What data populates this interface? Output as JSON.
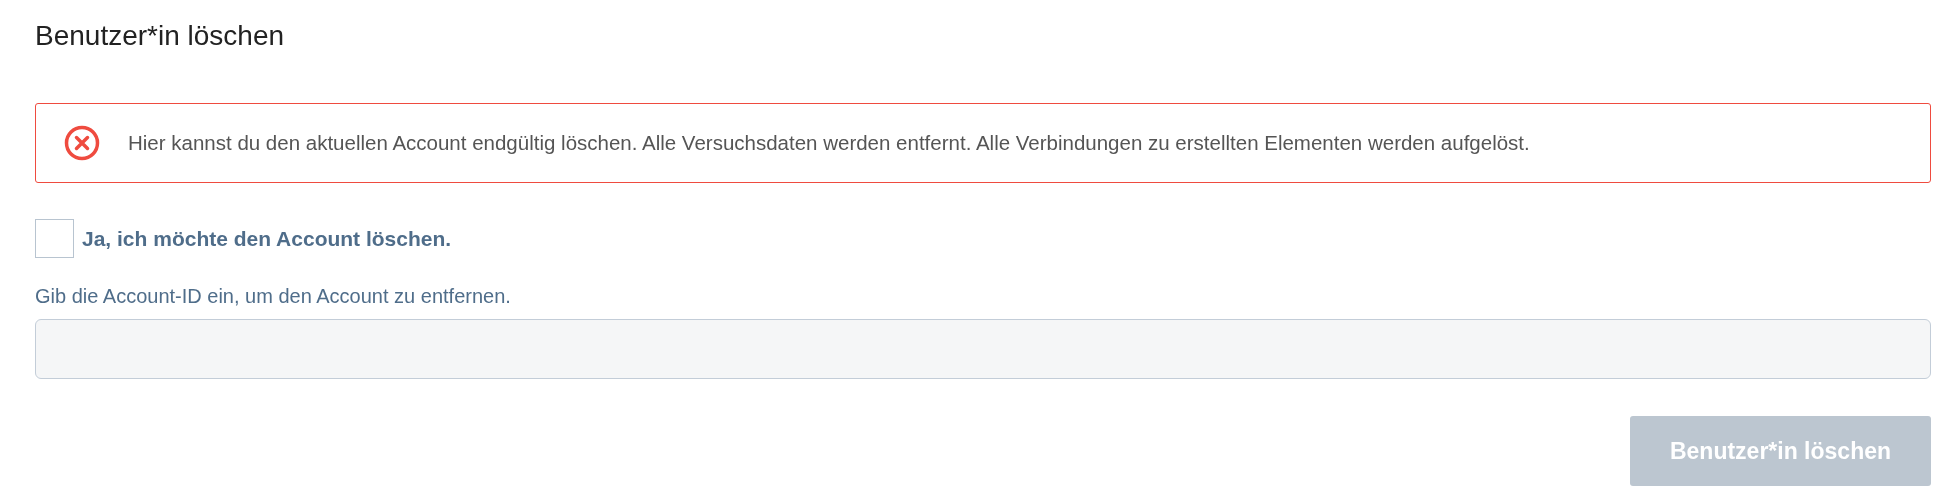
{
  "title": "Benutzer*in löschen",
  "alert": {
    "kind": "error",
    "text": "Hier kannst du den aktuellen Account endgültig löschen. Alle Versuchsdaten werden entfernt. Alle Verbindungen zu erstellten Elementen werden aufgelöst."
  },
  "confirm_checkbox": {
    "label": "Ja, ich möchte den Account löschen.",
    "checked": false
  },
  "account_id_field": {
    "label": "Gib die Account-ID ein, um den Account zu entfernen."
  },
  "delete_button": {
    "label": "Benutzer*in löschen",
    "disabled": true
  }
}
